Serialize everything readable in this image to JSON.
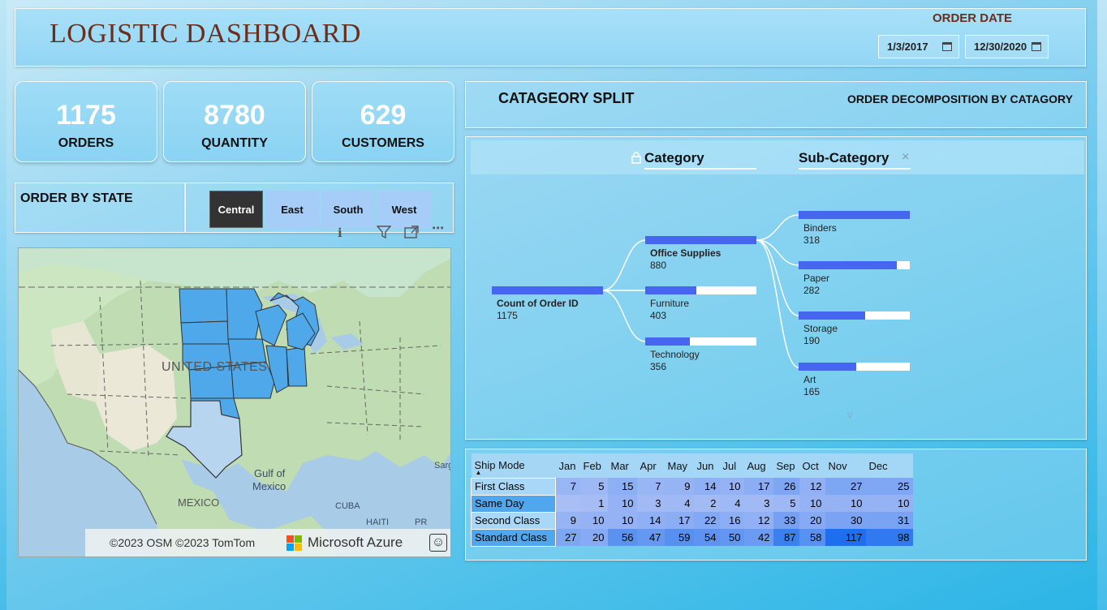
{
  "header": {
    "title": "LOGISTIC DASHBOARD",
    "order_date_label": "ORDER DATE",
    "date_start": "1/3/2017",
    "date_end": "12/30/2020"
  },
  "kpis": [
    {
      "value": "1175",
      "label": "ORDERS"
    },
    {
      "value": "8780",
      "label": "QUANTITY"
    },
    {
      "value": "629",
      "label": "CUSTOMERS"
    }
  ],
  "order_by_state": {
    "title": "ORDER BY STATE",
    "regions": [
      "Central",
      "East",
      "South",
      "West"
    ],
    "selected_region": "Central"
  },
  "map": {
    "labels": {
      "country": "UNITED STATES",
      "gulf": "Gulf of",
      "gulf2": "Mexico",
      "mexico": "MEXICO",
      "cuba": "CUBA",
      "haiti": "HAITI",
      "pr": "PR",
      "sarg": "Sarg"
    },
    "attribution": "©2023 OSM  ©2023 TomTom",
    "provider": "Microsoft Azure"
  },
  "category_split": {
    "title": "CATAGEORY SPLIT",
    "subtitle": "ORDER DECOMPOSITION BY CATAGORY",
    "level1_label": "Category",
    "level2_label": "Sub-Category",
    "root": {
      "name": "Count of Order ID",
      "value": 1175
    },
    "categories": [
      {
        "name": "Office Supplies",
        "value": 880
      },
      {
        "name": "Furniture",
        "value": 403
      },
      {
        "name": "Technology",
        "value": 356
      }
    ],
    "subcategories": [
      {
        "name": "Binders",
        "value": 318
      },
      {
        "name": "Paper",
        "value": 282
      },
      {
        "name": "Storage",
        "value": 190
      },
      {
        "name": "Art",
        "value": 165
      }
    ]
  },
  "matrix": {
    "row_header": "Ship Mode",
    "months": [
      "Jan",
      "Feb",
      "Mar",
      "Apr",
      "May",
      "Jun",
      "Jul",
      "Aug",
      "Sep",
      "Oct",
      "Nov",
      "Dec"
    ],
    "rows": [
      {
        "name": "First Class",
        "values": [
          "7",
          "5",
          "15",
          "7",
          "9",
          "14",
          "10",
          "17",
          "26",
          "12",
          "27",
          "25"
        ]
      },
      {
        "name": "Same Day",
        "values": [
          "",
          "1",
          "10",
          "3",
          "4",
          "2",
          "4",
          "3",
          "5",
          "10",
          "10",
          "10"
        ]
      },
      {
        "name": "Second Class",
        "values": [
          "9",
          "10",
          "10",
          "14",
          "17",
          "22",
          "16",
          "12",
          "33",
          "20",
          "30",
          "31"
        ]
      },
      {
        "name": "Standard Class",
        "values": [
          "27",
          "20",
          "56",
          "47",
          "59",
          "54",
          "50",
          "42",
          "87",
          "58",
          "117",
          "98"
        ]
      }
    ]
  },
  "colors": {
    "title_brown": "#6b2d1c",
    "bar_blue": "#4766f0",
    "map_highlight": "#4ea8ea",
    "heat_max": "#1e6ff0"
  }
}
